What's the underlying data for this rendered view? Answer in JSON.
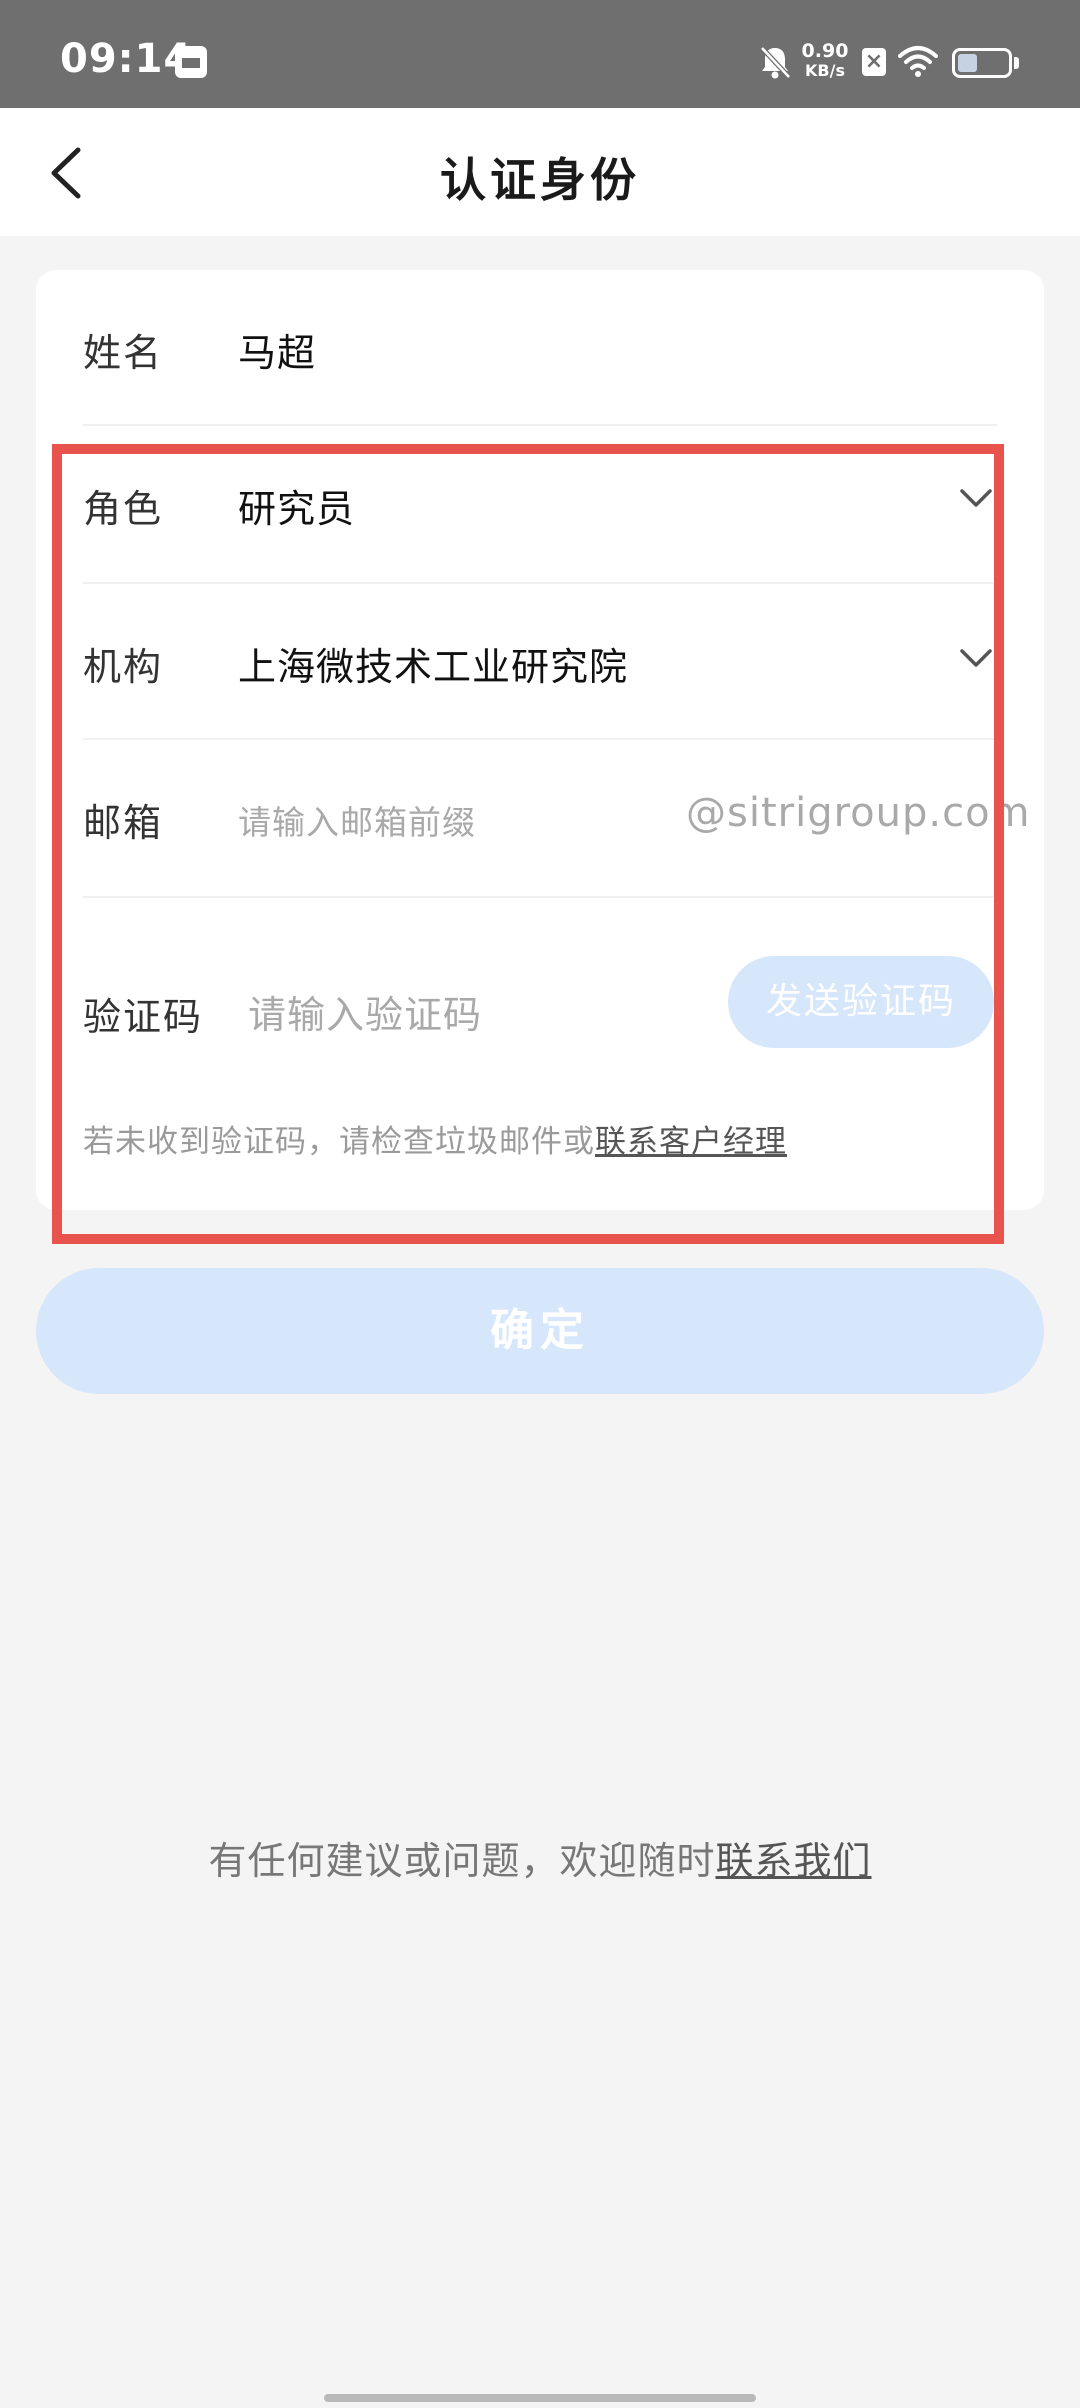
{
  "status_bar": {
    "time": "09:14",
    "speed_value": "0.90",
    "speed_unit": "KB/s",
    "icons": [
      "notification-app-icon",
      "mute-bell-icon",
      "close-badge-icon",
      "wifi-icon",
      "battery-icon"
    ],
    "battery_level": 0.4
  },
  "header": {
    "title": "认证身份"
  },
  "form": {
    "name": {
      "label": "姓名",
      "value": "马超"
    },
    "role": {
      "label": "角色",
      "value": "研究员"
    },
    "org": {
      "label": "机构",
      "value": "上海微技术工业研究院"
    },
    "email": {
      "label": "邮箱",
      "placeholder": "请输入邮箱前缀",
      "suffix": "@sitrigroup.com"
    },
    "code": {
      "label": "验证码",
      "placeholder": "请输入验证码",
      "send_button": "发送验证码"
    },
    "hint_text": "若未收到验证码，请检查垃圾邮件或",
    "hint_link": "联系客户经理"
  },
  "confirm_button": "确定",
  "footer": {
    "text": "有任何建议或问题，欢迎随时",
    "link": "联系我们"
  },
  "colors": {
    "accent_light": "#d6e6fb",
    "highlight": "#e8534e",
    "status_bar": "#6f6f6f"
  }
}
